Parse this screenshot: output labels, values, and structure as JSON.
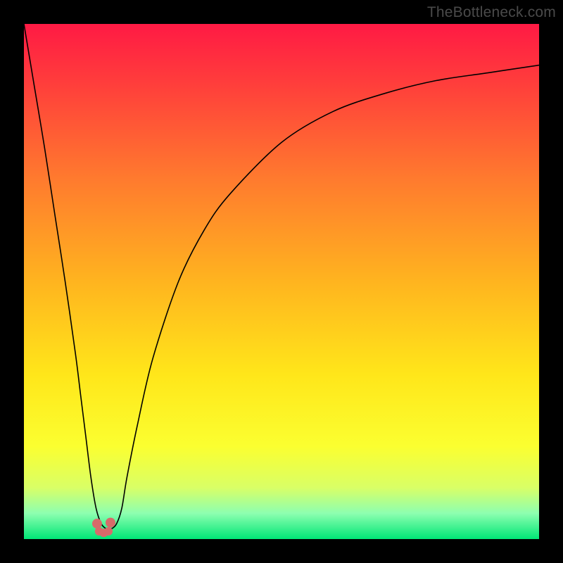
{
  "watermark": "TheBottleneck.com",
  "chart_data": {
    "type": "line",
    "title": "",
    "xlabel": "",
    "ylabel": "",
    "xlim": [
      0,
      100
    ],
    "ylim": [
      0,
      100
    ],
    "background_gradient_stops": [
      {
        "offset": 0.0,
        "color": "#ff1a44"
      },
      {
        "offset": 0.12,
        "color": "#ff3f3b"
      },
      {
        "offset": 0.3,
        "color": "#ff7a2e"
      },
      {
        "offset": 0.5,
        "color": "#ffb41f"
      },
      {
        "offset": 0.68,
        "color": "#ffe61a"
      },
      {
        "offset": 0.82,
        "color": "#fbff30"
      },
      {
        "offset": 0.9,
        "color": "#d9ff66"
      },
      {
        "offset": 0.95,
        "color": "#8dffb0"
      },
      {
        "offset": 1.0,
        "color": "#00e676"
      }
    ],
    "series": [
      {
        "name": "curve",
        "stroke": "#000000",
        "stroke_width": 1.6,
        "x": [
          0,
          2,
          4,
          6,
          8,
          10,
          11,
          12,
          13,
          14,
          15,
          16,
          17,
          18,
          19,
          20,
          22,
          25,
          30,
          35,
          40,
          50,
          60,
          70,
          80,
          90,
          100
        ],
        "y": [
          100,
          88,
          76,
          63,
          50,
          36,
          28,
          20,
          12,
          6,
          3,
          2,
          2,
          3,
          6,
          12,
          22,
          35,
          50,
          60,
          67,
          77,
          83,
          86.5,
          89,
          90.5,
          92
        ]
      }
    ],
    "markers": [
      {
        "x": 14.2,
        "y": 3.0,
        "r": 7,
        "color": "#d86a6a"
      },
      {
        "x": 16.8,
        "y": 3.2,
        "r": 7,
        "color": "#d86a6a"
      },
      {
        "x": 14.6,
        "y": 1.5,
        "r": 6,
        "color": "#d86a6a"
      },
      {
        "x": 16.4,
        "y": 1.5,
        "r": 6,
        "color": "#d86a6a"
      },
      {
        "x": 15.5,
        "y": 1.2,
        "r": 6,
        "color": "#d86a6a"
      }
    ]
  }
}
